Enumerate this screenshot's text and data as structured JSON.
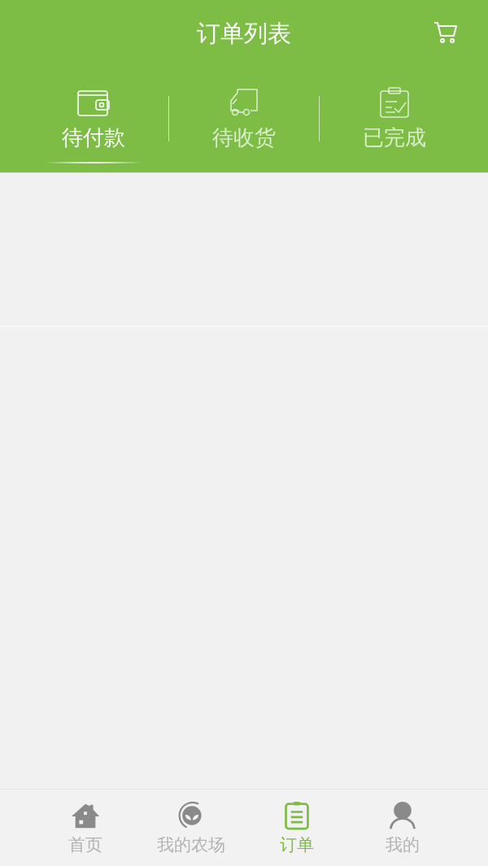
{
  "header": {
    "title": "订单列表"
  },
  "tabs": [
    {
      "label": "待付款",
      "kind": "wallet",
      "selected": true
    },
    {
      "label": "待收货",
      "kind": "truck",
      "selected": false
    },
    {
      "label": "已完成",
      "kind": "clipboard",
      "selected": false
    }
  ],
  "bottom_nav": [
    {
      "label": "首页",
      "kind": "home",
      "selected": false
    },
    {
      "label": "我的农场",
      "kind": "farm",
      "selected": false
    },
    {
      "label": "订单",
      "kind": "orders",
      "selected": true
    },
    {
      "label": "我的",
      "kind": "profile",
      "selected": false
    }
  ]
}
